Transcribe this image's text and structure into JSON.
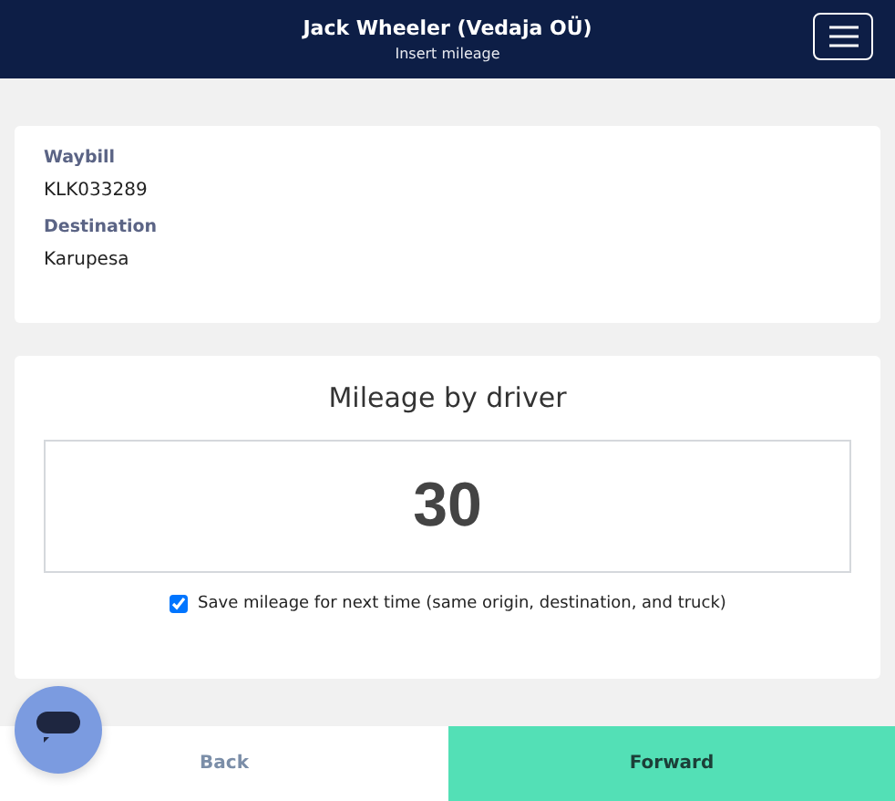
{
  "header": {
    "title": "Jack Wheeler (Vedaja OÜ)",
    "subtitle": "Insert mileage"
  },
  "details": [
    {
      "label": "Waybill",
      "value": "KLK033289"
    },
    {
      "label": "Destination",
      "value": "Karupesa"
    }
  ],
  "mileage": {
    "title": "Mileage by driver",
    "value": "30",
    "save": {
      "label": "Save mileage for next time (same origin, destination, and truck)",
      "checked": true
    }
  },
  "footer": {
    "back": "Back",
    "forward": "Forward"
  }
}
